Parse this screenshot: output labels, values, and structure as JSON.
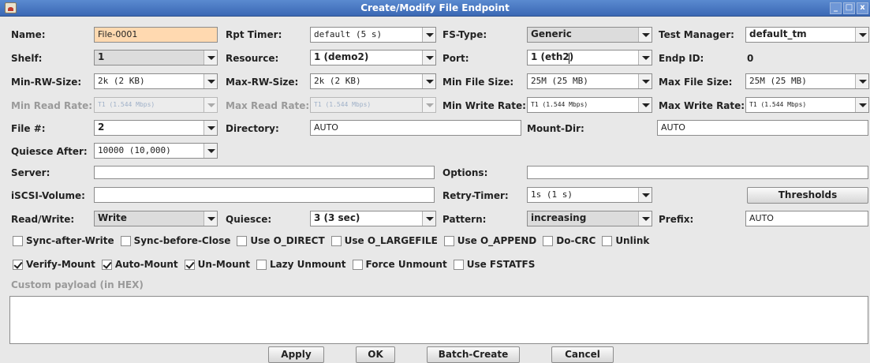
{
  "window": {
    "title": "Create/Modify File Endpoint",
    "buttons": [
      "_",
      "□",
      "x"
    ]
  },
  "labels": {
    "name": "Name:",
    "rpt_timer": "Rpt Timer:",
    "fs_type": "FS-Type:",
    "test_manager": "Test Manager:",
    "shelf": "Shelf:",
    "resource": "Resource:",
    "port": "Port:",
    "endp_id": "Endp ID:",
    "min_rw_size": "Min-RW-Size:",
    "max_rw_size": "Max-RW-Size:",
    "min_file_size": "Min File Size:",
    "max_file_size": "Max File Size:",
    "min_read_rate": "Min Read Rate:",
    "max_read_rate": "Max Read Rate:",
    "min_write_rate": "Min Write Rate:",
    "max_write_rate": "Max Write Rate:",
    "file_num": "File #:",
    "directory": "Directory:",
    "mount_dir": "Mount-Dir:",
    "quiesce_after": "Quiesce After:",
    "server": "Server:",
    "options": "Options:",
    "iscsi_volume": "iSCSI-Volume:",
    "retry_timer": "Retry-Timer:",
    "read_write": "Read/Write:",
    "quiesce": "Quiesce:",
    "pattern": "Pattern:",
    "prefix": "Prefix:",
    "custom_payload": "Custom payload (in HEX)"
  },
  "values": {
    "name": "File-0001",
    "rpt_timer": "default (5 s)",
    "fs_type": "Generic",
    "test_manager": "default_tm",
    "shelf": "1",
    "resource": "1 (demo2)",
    "port": "1 (eth2)",
    "endp_id": "0",
    "min_rw_size": "2k (2 KB)",
    "max_rw_size": "2k (2 KB)",
    "min_file_size": "25M    (25 MB)",
    "max_file_size": "25M    (25 MB)",
    "min_read_rate": "T1        (1.544 Mbps)",
    "max_read_rate": "T1        (1.544 Mbps)",
    "min_write_rate": "T1        (1.544 Mbps)",
    "max_write_rate": "T1        (1.544 Mbps)",
    "file_num": "2",
    "directory": "AUTO",
    "mount_dir": "AUTO",
    "quiesce_after": "10000   (10,000)",
    "server": "",
    "options": "",
    "iscsi_volume": "",
    "retry_timer": "1s     (1 s)",
    "read_write": "Write",
    "quiesce": "3 (3 sec)",
    "pattern": "increasing",
    "prefix": "AUTO",
    "custom_payload": ""
  },
  "checkboxes_row1": [
    {
      "label": "Sync-after-Write",
      "checked": false
    },
    {
      "label": "Sync-before-Close",
      "checked": false
    },
    {
      "label": "Use O_DIRECT",
      "checked": false
    },
    {
      "label": "Use O_LARGEFILE",
      "checked": false
    },
    {
      "label": "Use O_APPEND",
      "checked": false
    },
    {
      "label": "Do-CRC",
      "checked": false
    },
    {
      "label": "Unlink",
      "checked": false
    }
  ],
  "checkboxes_row2": [
    {
      "label": "Verify-Mount",
      "checked": true
    },
    {
      "label": "Auto-Mount",
      "checked": true
    },
    {
      "label": "Un-Mount",
      "checked": true
    },
    {
      "label": "Lazy Unmount",
      "checked": false
    },
    {
      "label": "Force Unmount",
      "checked": false
    },
    {
      "label": "Use FSTATFS",
      "checked": false
    }
  ],
  "buttons": {
    "thresholds": "Thresholds",
    "apply": "Apply",
    "ok": "OK",
    "batch_create": "Batch-Create",
    "cancel": "Cancel"
  },
  "colors": {
    "titlebar": "#3b68b4",
    "name_field": "#ffd9b0",
    "disabled_text": "#9a9a9a"
  }
}
